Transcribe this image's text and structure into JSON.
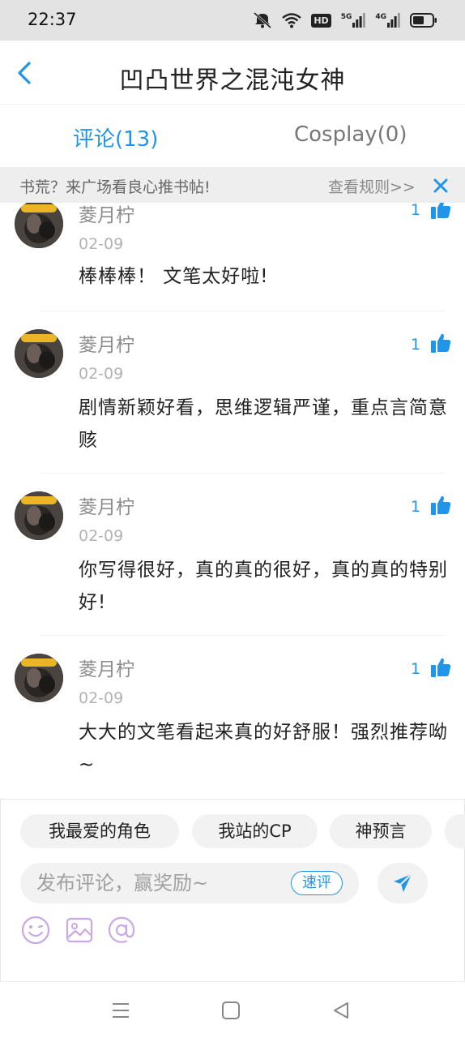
{
  "status_bar": {
    "time": "22:37",
    "hd_badge": "HD",
    "net1": "5G",
    "net2": "4G"
  },
  "header": {
    "back_icon": "chevron-left-icon",
    "title": "凹凸世界之混沌女神"
  },
  "tabs": [
    {
      "label": "评论(13)",
      "active": true
    },
    {
      "label": "Cosplay(0)",
      "active": false
    }
  ],
  "notice": {
    "text": "书荒？来广场看良心推书帖!",
    "link": "查看规则>>",
    "close_icon": "close-icon"
  },
  "comments": [
    {
      "author": "菱月柠",
      "date": "02-09",
      "text": "棒棒棒！ 文笔太好啦!",
      "likes": "1"
    },
    {
      "author": "菱月柠",
      "date": "02-09",
      "text": "剧情新颖好看，思维逻辑严谨，重点言简意赅",
      "likes": "1"
    },
    {
      "author": "菱月柠",
      "date": "02-09",
      "text": "你写得很好，真的真的很好，真的真的特别好!",
      "likes": "1"
    },
    {
      "author": "菱月柠",
      "date": "02-09",
      "text": "大大的文笔看起来真的好舒服！强烈推荐呦 ~",
      "likes": "1"
    }
  ],
  "composer": {
    "chips": [
      "我最爱的角色",
      "我站的CP",
      "神预言"
    ],
    "placeholder": "发布评论，赢奖励~",
    "quick_review": "速评",
    "icons": [
      "emoji-icon",
      "image-icon",
      "mention-icon"
    ]
  },
  "colors": {
    "accent": "#2196e8",
    "icon_purple": "#c9a8e6"
  }
}
